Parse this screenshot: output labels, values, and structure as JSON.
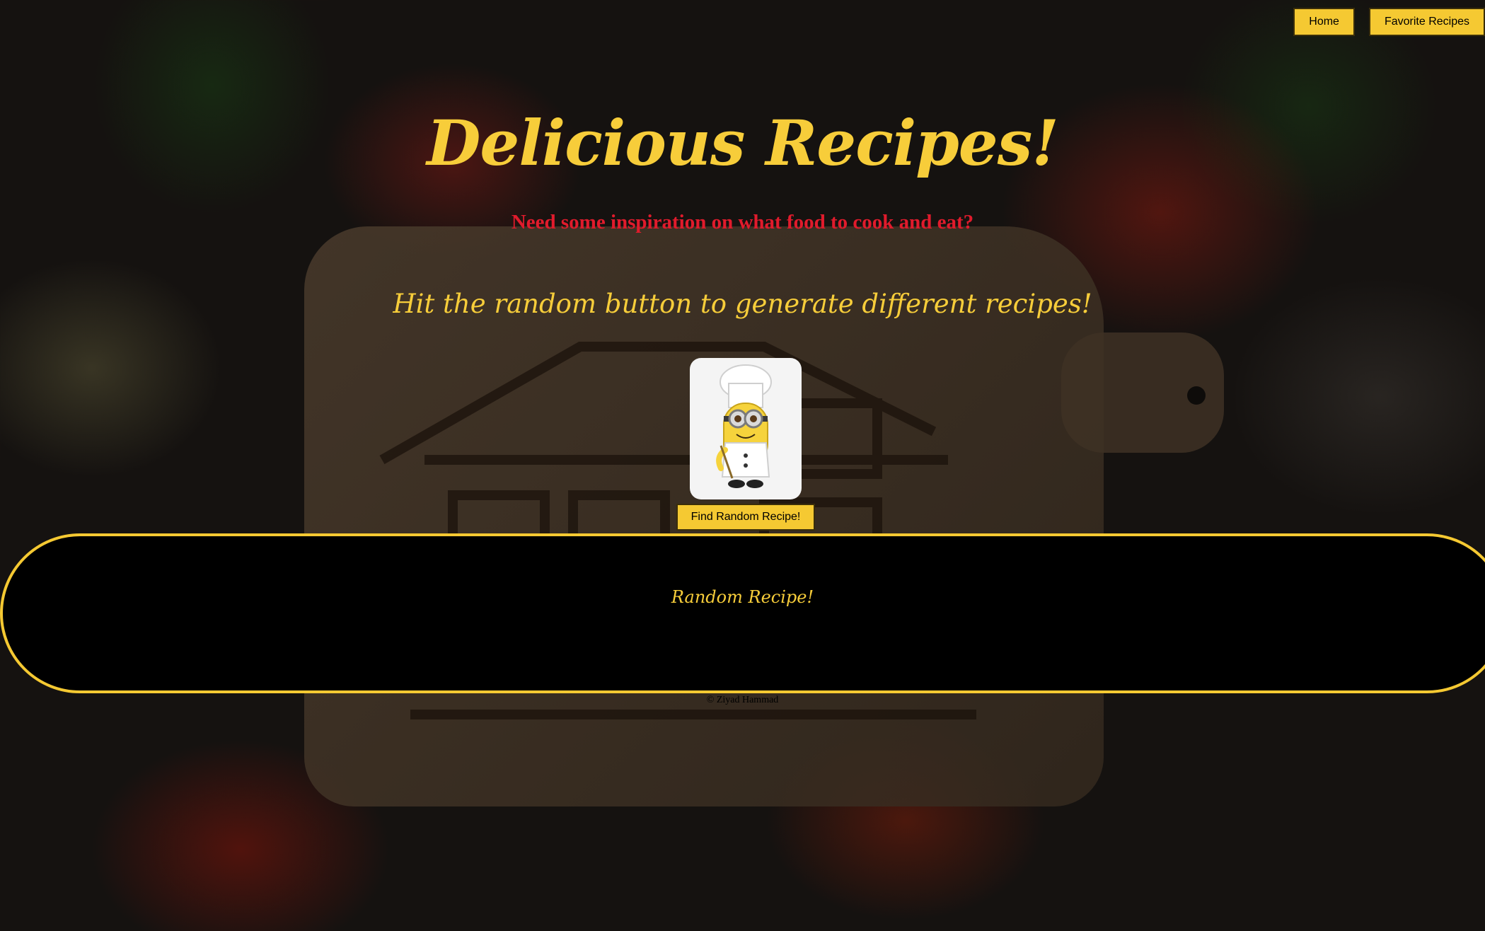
{
  "nav": {
    "home_label": "Home",
    "favorites_label": "Favorite Recipes"
  },
  "header": {
    "title": "Delicious Recipes!",
    "subtitle": "Need some inspiration on what food to cook and eat?",
    "tagline": "Hit the random button to generate different recipes!"
  },
  "main": {
    "find_button_label": "Find Random Recipe!",
    "recipe_title": "Random Recipe!"
  },
  "footer": {
    "credit": "© Ziyad Hammad"
  },
  "colors": {
    "accent": "#f5c932",
    "subtitle": "#e01b2c",
    "panel": "#000000"
  },
  "icons": {
    "chef_image": "minion-chef-image"
  }
}
